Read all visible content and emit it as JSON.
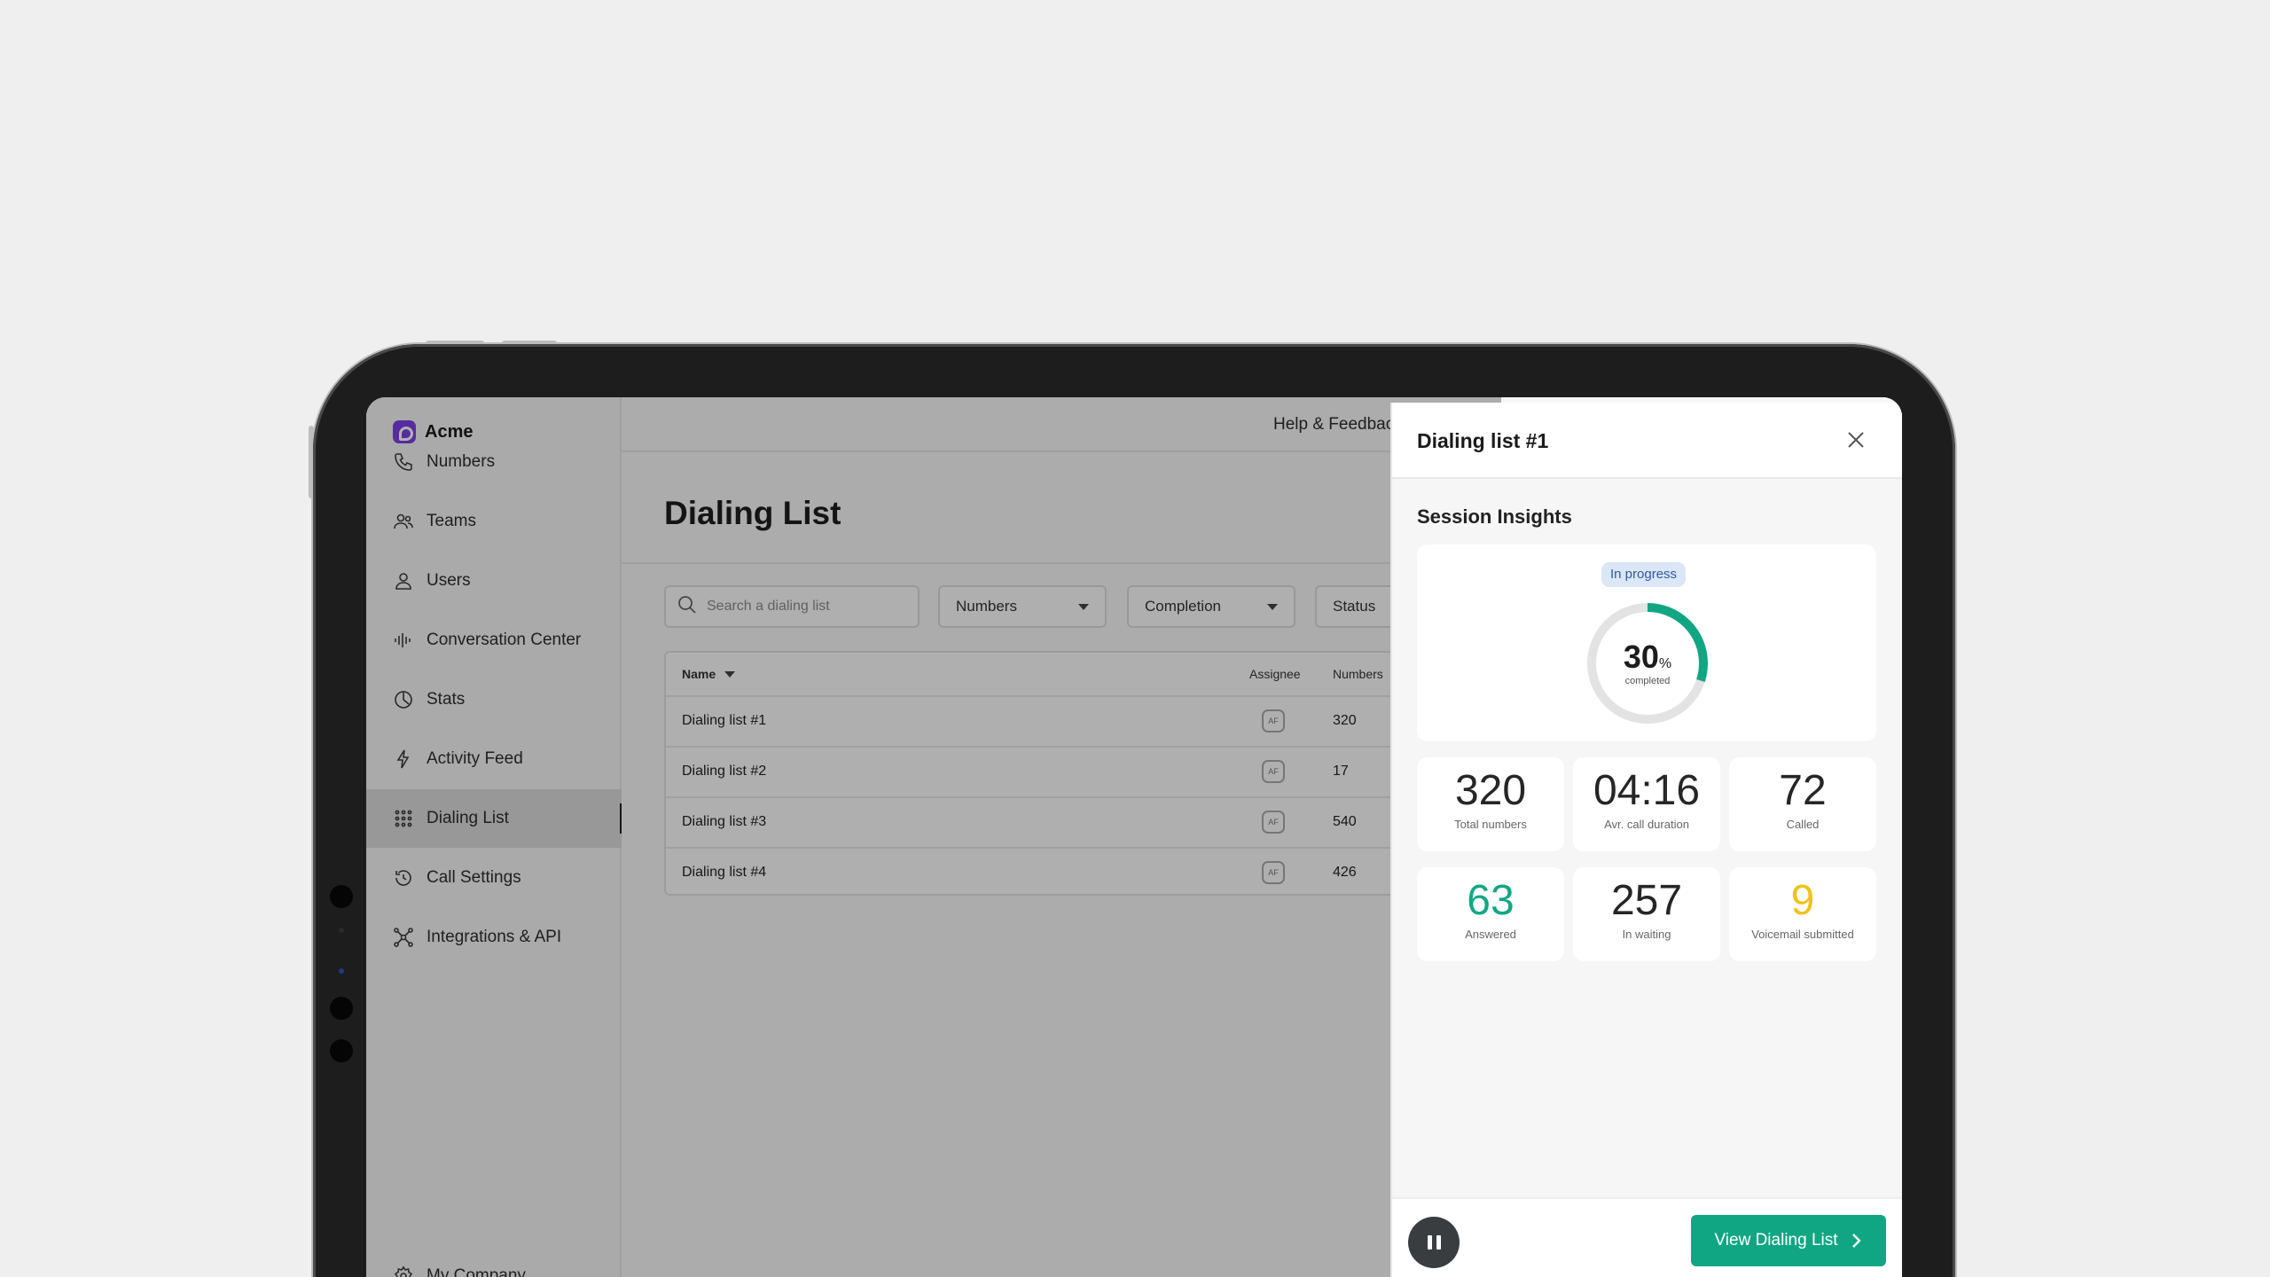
{
  "brand": {
    "name": "Acme"
  },
  "sidebar": {
    "items": [
      {
        "label": "Numbers",
        "icon": "phone-icon"
      },
      {
        "label": "Teams",
        "icon": "team-icon"
      },
      {
        "label": "Users",
        "icon": "user-icon"
      },
      {
        "label": "Conversation Center",
        "icon": "soundwave-icon"
      },
      {
        "label": "Stats",
        "icon": "pie-chart-icon"
      },
      {
        "label": "Activity Feed",
        "icon": "lightning-icon"
      },
      {
        "label": "Dialing List",
        "icon": "dial-grid-icon",
        "active": true
      },
      {
        "label": "Call Settings",
        "icon": "history-icon"
      },
      {
        "label": "Integrations & API",
        "icon": "integrations-icon"
      }
    ],
    "footer": {
      "label": "My Company",
      "icon": "gear-icon"
    }
  },
  "topbar": {
    "help": "Help & Feedback"
  },
  "main": {
    "title": "Dialing List",
    "search": {
      "placeholder": "Search a dialing list"
    },
    "filters": [
      "Numbers",
      "Completion",
      "Status"
    ],
    "table": {
      "headers": {
        "name": "Name",
        "assignee": "Assignee",
        "numbers": "Numbers"
      },
      "rows": [
        {
          "name": "Dialing list  #1",
          "assignee": "AF",
          "numbers": "320"
        },
        {
          "name": "Dialing list  #2",
          "assignee": "AF",
          "numbers": "17"
        },
        {
          "name": "Dialing list  #3",
          "assignee": "AF",
          "numbers": "540"
        },
        {
          "name": "Dialing list  #4",
          "assignee": "AF",
          "numbers": "426"
        }
      ]
    }
  },
  "panel": {
    "title": "Dialing list #1",
    "section_title": "Session Insights",
    "status": "In progress",
    "progress": {
      "value": "30",
      "percent": 30,
      "unit": "%",
      "label": "completed"
    },
    "stats": [
      {
        "value": "320",
        "label": "Total numbers",
        "color": "#262626"
      },
      {
        "value": "04:16",
        "label": "Avr. call duration",
        "color": "#262626"
      },
      {
        "value": "72",
        "label": "Called",
        "color": "#262626"
      },
      {
        "value": "63",
        "label": "Answered",
        "color": "#12a785"
      },
      {
        "value": "257",
        "label": "In waiting",
        "color": "#262626"
      },
      {
        "value": "9",
        "label": "Voicemail submitted",
        "color": "#f0c21b"
      }
    ],
    "cta": "View Dialing List"
  },
  "colors": {
    "accent": "#11a683",
    "brand": "#7b3fe4",
    "warning": "#f0c21b"
  }
}
